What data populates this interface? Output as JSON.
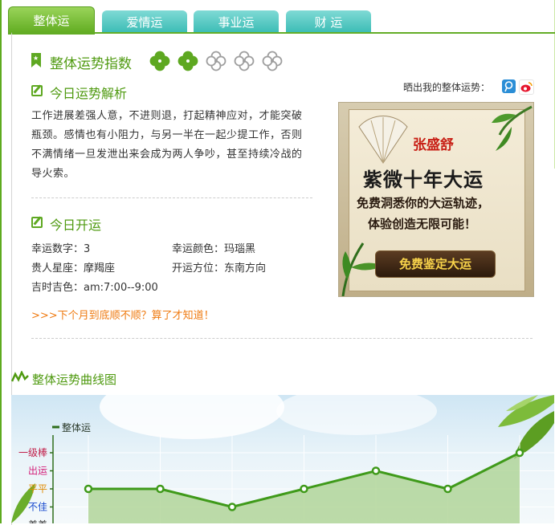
{
  "tabs": [
    {
      "label": "整体运",
      "active": true
    },
    {
      "label": "爱情运",
      "active": false
    },
    {
      "label": "事业运",
      "active": false
    },
    {
      "label": "财 运",
      "active": false
    }
  ],
  "index_section": {
    "title": "整体运势指数",
    "rating": 2,
    "max": 5,
    "icon": "clover-icon",
    "colors": {
      "on": "#5ea821",
      "off": "#9e9e9e"
    }
  },
  "analysis": {
    "title": "今日运势解析",
    "text": "工作进展差强人意，不进则退，打起精神应对，才能突破瓶颈。感情也有小阻力，与另一半在一起少提工作，否则不满情绪一旦发泄出来会成为两人争吵，甚至持续冷战的导火索。"
  },
  "share": {
    "label": "晒出我的整体运势：",
    "icons": [
      "tencent-weibo-icon",
      "sina-weibo-icon"
    ]
  },
  "lucky": {
    "title": "今日开运",
    "items": [
      {
        "label": "幸运数字：",
        "value": "3"
      },
      {
        "label": "幸运颜色：",
        "value": "玛瑙黑"
      },
      {
        "label": "贵人星座：",
        "value": "摩羯座"
      },
      {
        "label": "开运方位：",
        "value": "东南方向"
      },
      {
        "label": "吉时吉色：",
        "value": "am:7:00--9:00"
      }
    ]
  },
  "promo_link": ">>>下个月到底顺不顺？算了才知道！",
  "ad": {
    "name": "张盛舒",
    "headline": "紫微十年大运",
    "line1": "免费洞悉你的大运轨迹，",
    "line2": "体验创造无限可能！",
    "button": "免费鉴定大运"
  },
  "curve": {
    "title": "整体运势曲线图"
  },
  "chart_data": {
    "type": "line",
    "title": "",
    "series": [
      {
        "name": "整体运",
        "values": [
          3,
          3,
          2,
          3,
          4,
          3,
          5
        ]
      }
    ],
    "y_levels": [
      "差差",
      "不佳",
      "平平",
      "出运",
      "一级棒"
    ],
    "y_level_colors": [
      "#333333",
      "#1a4ccf",
      "#e08a00",
      "#d4207a",
      "#c21f4a"
    ],
    "ylim": [
      1,
      5
    ],
    "grid": true,
    "legend": "top-left",
    "colors": {
      "line": "#3f9a1a",
      "fill": "#a8d08c"
    }
  }
}
